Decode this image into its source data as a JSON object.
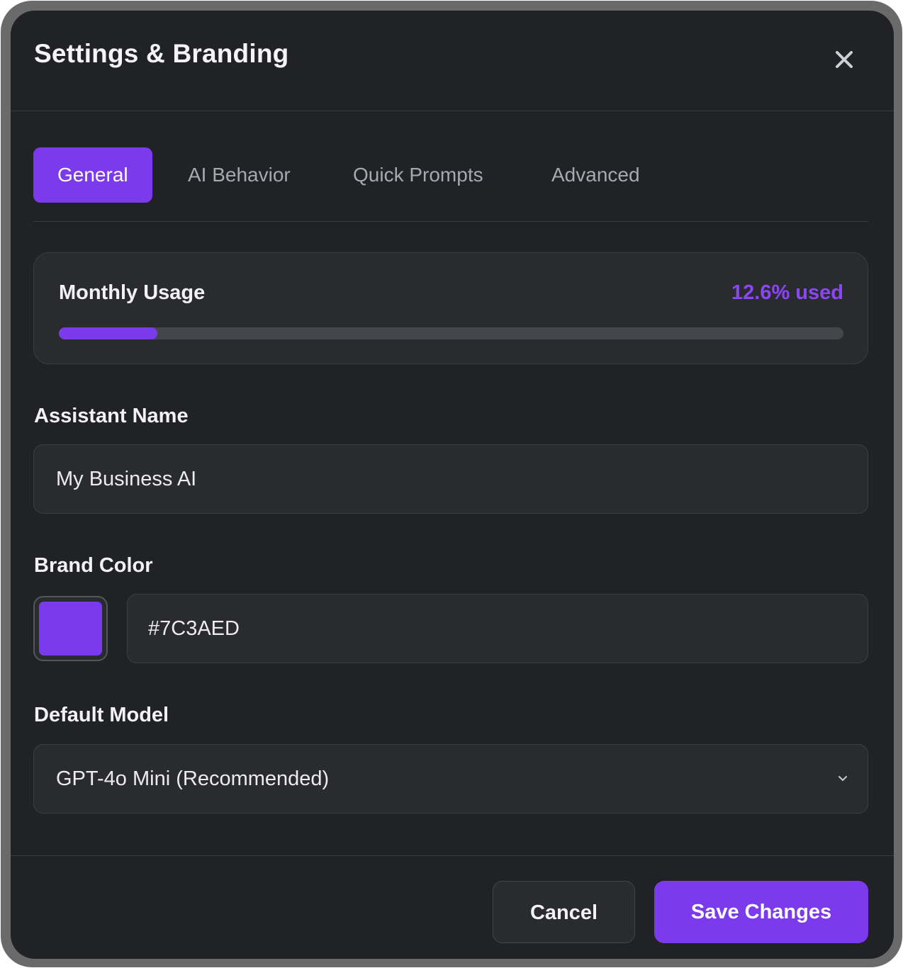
{
  "dialog": {
    "title": "Settings & Branding",
    "close_icon": "close-icon"
  },
  "tabs": [
    {
      "label": "General",
      "active": true
    },
    {
      "label": "AI Behavior",
      "active": false
    },
    {
      "label": "Quick Prompts",
      "active": false
    },
    {
      "label": "Advanced",
      "active": false
    }
  ],
  "usage": {
    "label": "Monthly Usage",
    "value_text": "12.6% used",
    "percent": 12.6
  },
  "assistant_name": {
    "label": "Assistant Name",
    "value": "My Business AI"
  },
  "brand_color": {
    "label": "Brand Color",
    "value": "#7C3AED",
    "swatch_color": "#7C3AED"
  },
  "default_model": {
    "label": "Default Model",
    "selected": "GPT-4o Mini (Recommended)",
    "icon": "chevron-down-icon"
  },
  "footer": {
    "cancel_label": "Cancel",
    "save_label": "Save Changes"
  },
  "colors": {
    "accent": "#7C3AED",
    "background": "#212225",
    "surface": "#2A2B2F"
  }
}
